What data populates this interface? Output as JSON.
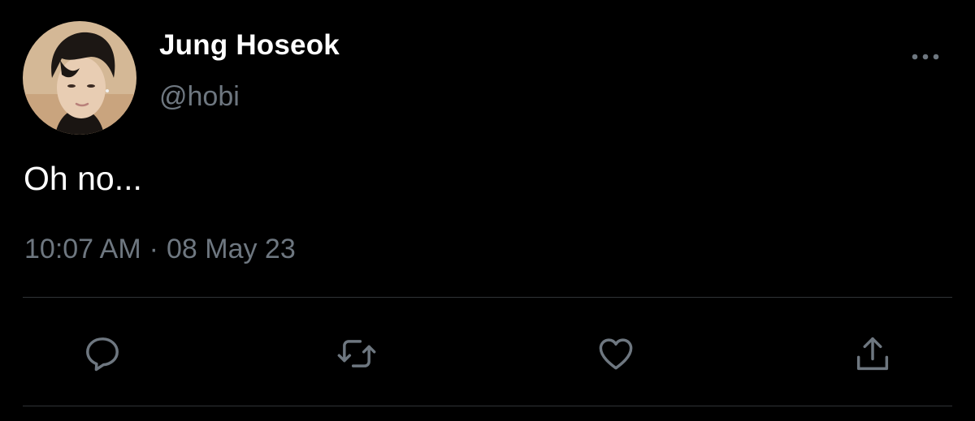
{
  "tweet": {
    "display_name": "Jung Hoseok",
    "handle": "@hobi",
    "text": "Oh no...",
    "time": "10:07 AM",
    "separator": "·",
    "date": "08 May 23"
  },
  "icons": {
    "more": "more-horizontal-icon",
    "reply": "reply-icon",
    "retweet": "retweet-icon",
    "like": "heart-icon",
    "share": "share-icon"
  },
  "colors": {
    "background": "#000000",
    "primary_text": "#ffffff",
    "secondary_text": "#6e7780",
    "divider": "#2f3336"
  }
}
